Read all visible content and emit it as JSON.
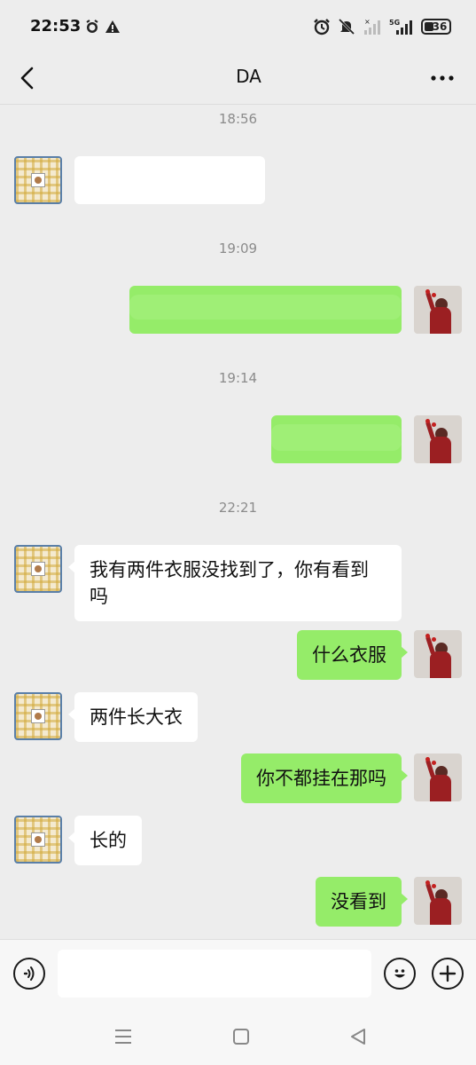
{
  "status_bar": {
    "time": "22:53",
    "battery_level": "36",
    "network_label": "5G"
  },
  "header": {
    "title": "DA"
  },
  "messages": [
    {
      "type": "time",
      "text": "18:56"
    },
    {
      "type": "in",
      "text": "",
      "redacted": true
    },
    {
      "type": "time",
      "text": "19:09"
    },
    {
      "type": "out",
      "text": "",
      "redacted": true
    },
    {
      "type": "time",
      "text": "19:14"
    },
    {
      "type": "out",
      "text": "",
      "redacted": true
    },
    {
      "type": "time",
      "text": "22:21"
    },
    {
      "type": "in",
      "text": "我有两件衣服没找到了，你有看到吗"
    },
    {
      "type": "out",
      "text": "什么衣服"
    },
    {
      "type": "in",
      "text": "两件长大衣"
    },
    {
      "type": "out",
      "text": "你不都挂在那吗"
    },
    {
      "type": "in",
      "text": "长的"
    },
    {
      "type": "out",
      "text": "没看到"
    }
  ],
  "input": {
    "value": "",
    "placeholder": ""
  },
  "icons": {
    "back": "chevron-left-icon",
    "more": "more-horizontal-icon",
    "voice": "voice-icon",
    "emoji": "emoji-icon",
    "plus": "plus-icon",
    "recent_apps": "menu-lines-icon",
    "home": "square-home-icon",
    "system_back": "triangle-back-icon"
  },
  "colors": {
    "background": "#ededed",
    "outgoing_bubble": "#95ec69",
    "incoming_bubble": "#ffffff",
    "timestamp_text": "#8b8b8b"
  }
}
